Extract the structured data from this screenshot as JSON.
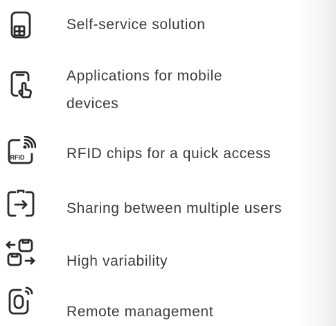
{
  "features": [
    {
      "label": "Self-service solution",
      "icon": "tablet-grid-icon"
    },
    {
      "label": "Applications for mobile devices",
      "icon": "phone-touch-icon"
    },
    {
      "label": "RFID chips for a quick access",
      "icon": "rfid-icon"
    },
    {
      "label": "Sharing between multiple users",
      "icon": "share-arrow-icon"
    },
    {
      "label": "High variability",
      "icon": "swap-arrows-icon"
    },
    {
      "label": "Remote management",
      "icon": "remote-signal-icon"
    }
  ],
  "rfid_icon_text": "RFID",
  "colors": {
    "text": "#3b3b3b",
    "icon": "#2a2a2a"
  }
}
